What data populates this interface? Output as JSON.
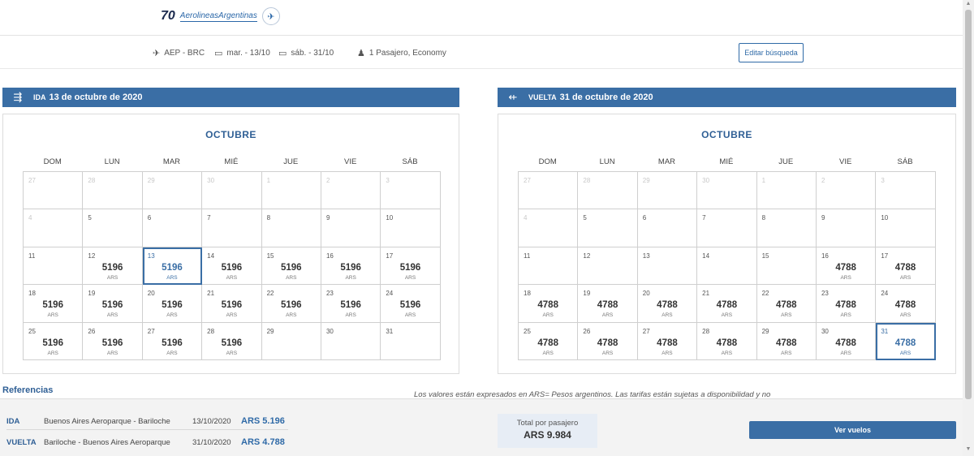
{
  "header": {
    "logo_number": "70",
    "logo_text": "AerolineasArgentinas"
  },
  "search": {
    "route": "AEP - BRC",
    "depart": "mar. - 13/10",
    "return": "sáb. - 31/10",
    "passengers": "1 Pasajero, Economy",
    "edit_label": "Editar búsqueda"
  },
  "outbound": {
    "type_label": "IDA",
    "date_label": "13 de octubre de 2020",
    "month": "OCTUBRE",
    "weekdays": [
      "DOM",
      "LUN",
      "MAR",
      "MIÉ",
      "JUE",
      "VIE",
      "SÁB"
    ],
    "days": [
      {
        "d": "27",
        "other": true
      },
      {
        "d": "28",
        "other": true
      },
      {
        "d": "29",
        "other": true
      },
      {
        "d": "30",
        "other": true
      },
      {
        "d": "1",
        "other": true
      },
      {
        "d": "2",
        "other": true
      },
      {
        "d": "3",
        "other": true
      },
      {
        "d": "4",
        "other": true
      },
      {
        "d": "5"
      },
      {
        "d": "6"
      },
      {
        "d": "7"
      },
      {
        "d": "8"
      },
      {
        "d": "9"
      },
      {
        "d": "10"
      },
      {
        "d": "11"
      },
      {
        "d": "12",
        "price": "5196",
        "cur": "ARS"
      },
      {
        "d": "13",
        "price": "5196",
        "cur": "ARS",
        "selected": true
      },
      {
        "d": "14",
        "price": "5196",
        "cur": "ARS"
      },
      {
        "d": "15",
        "price": "5196",
        "cur": "ARS"
      },
      {
        "d": "16",
        "price": "5196",
        "cur": "ARS"
      },
      {
        "d": "17",
        "price": "5196",
        "cur": "ARS"
      },
      {
        "d": "18",
        "price": "5196",
        "cur": "ARS"
      },
      {
        "d": "19",
        "price": "5196",
        "cur": "ARS"
      },
      {
        "d": "20",
        "price": "5196",
        "cur": "ARS"
      },
      {
        "d": "21",
        "price": "5196",
        "cur": "ARS"
      },
      {
        "d": "22",
        "price": "5196",
        "cur": "ARS"
      },
      {
        "d": "23",
        "price": "5196",
        "cur": "ARS"
      },
      {
        "d": "24",
        "price": "5196",
        "cur": "ARS"
      },
      {
        "d": "25",
        "price": "5196",
        "cur": "ARS"
      },
      {
        "d": "26",
        "price": "5196",
        "cur": "ARS"
      },
      {
        "d": "27",
        "price": "5196",
        "cur": "ARS"
      },
      {
        "d": "28",
        "price": "5196",
        "cur": "ARS"
      },
      {
        "d": "29"
      },
      {
        "d": "30"
      },
      {
        "d": "31"
      }
    ]
  },
  "inbound": {
    "type_label": "VUELTA",
    "date_label": "31 de octubre de 2020",
    "month": "OCTUBRE",
    "weekdays": [
      "DOM",
      "LUN",
      "MAR",
      "MIÉ",
      "JUE",
      "VIE",
      "SÁB"
    ],
    "days": [
      {
        "d": "27",
        "other": true
      },
      {
        "d": "28",
        "other": true
      },
      {
        "d": "29",
        "other": true
      },
      {
        "d": "30",
        "other": true
      },
      {
        "d": "1",
        "other": true
      },
      {
        "d": "2",
        "other": true
      },
      {
        "d": "3",
        "other": true
      },
      {
        "d": "4",
        "other": true
      },
      {
        "d": "5"
      },
      {
        "d": "6"
      },
      {
        "d": "7"
      },
      {
        "d": "8"
      },
      {
        "d": "9"
      },
      {
        "d": "10"
      },
      {
        "d": "11"
      },
      {
        "d": "12"
      },
      {
        "d": "13"
      },
      {
        "d": "14"
      },
      {
        "d": "15"
      },
      {
        "d": "16",
        "price": "4788",
        "cur": "ARS"
      },
      {
        "d": "17",
        "price": "4788",
        "cur": "ARS"
      },
      {
        "d": "18",
        "price": "4788",
        "cur": "ARS"
      },
      {
        "d": "19",
        "price": "4788",
        "cur": "ARS"
      },
      {
        "d": "20",
        "price": "4788",
        "cur": "ARS"
      },
      {
        "d": "21",
        "price": "4788",
        "cur": "ARS"
      },
      {
        "d": "22",
        "price": "4788",
        "cur": "ARS"
      },
      {
        "d": "23",
        "price": "4788",
        "cur": "ARS"
      },
      {
        "d": "24",
        "price": "4788",
        "cur": "ARS"
      },
      {
        "d": "25",
        "price": "4788",
        "cur": "ARS"
      },
      {
        "d": "26",
        "price": "4788",
        "cur": "ARS"
      },
      {
        "d": "27",
        "price": "4788",
        "cur": "ARS"
      },
      {
        "d": "28",
        "price": "4788",
        "cur": "ARS"
      },
      {
        "d": "29",
        "price": "4788",
        "cur": "ARS"
      },
      {
        "d": "30",
        "price": "4788",
        "cur": "ARS"
      },
      {
        "d": "31",
        "price": "4788",
        "cur": "ARS",
        "selected": true
      }
    ]
  },
  "references": {
    "title": "Referencias",
    "note": "Los valores están expresados en ARS= Pesos argentinos. Las tarifas están sujetas a disponibilidad y no",
    "ida": {
      "label": "IDA",
      "route": "Buenos Aires Aeroparque - Bariloche",
      "date": "13/10/2020",
      "price": "ARS 5.196"
    },
    "vuelta": {
      "label": "VUELTA",
      "route": "Bariloche - Buenos Aires Aeroparque",
      "date": "31/10/2020",
      "price": "ARS 4.788"
    }
  },
  "total": {
    "label": "Total por pasajero",
    "value": "ARS 9.984"
  },
  "actions": {
    "view_flights": "Ver vuelos"
  },
  "colors": {
    "primary": "#3a6ea5",
    "accent_text": "#2f5f95"
  }
}
